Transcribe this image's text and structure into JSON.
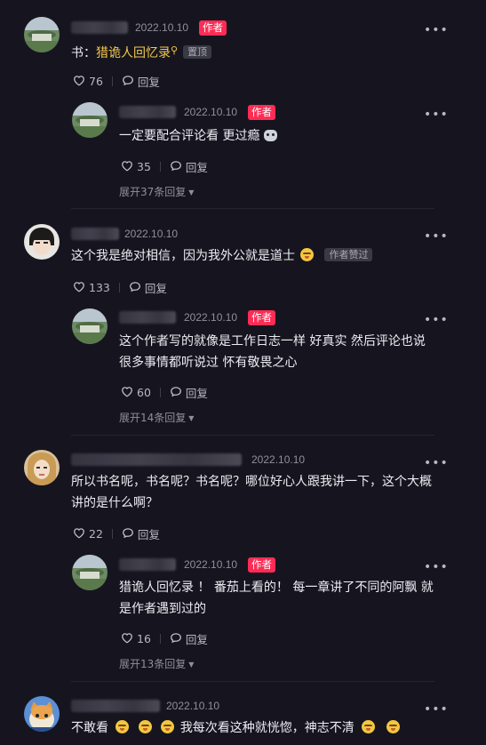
{
  "comments": [
    {
      "date": "2022.10.10",
      "author_badge": "作者",
      "text_prefix": "书：",
      "text_link": "猎诡人回忆录",
      "pin_label": "置顶",
      "likes": "76",
      "reply_label": "回复",
      "reply": {
        "date": "2022.10.10",
        "author_badge": "作者",
        "text": "一定要配合评论看 更过瘾",
        "likes": "35",
        "reply_label": "回复",
        "expand_label": "展开37条回复"
      }
    },
    {
      "date": "2022.10.10",
      "text": "这个我是绝对相信，因为我外公就是道士",
      "liked_label": "作者赞过",
      "likes": "133",
      "reply_label": "回复",
      "reply": {
        "date": "2022.10.10",
        "author_badge": "作者",
        "text_line1": "这个作者写的就像是工作日志一样 好真实 然后评论也说",
        "text_line2": "很多事情都听说过 怀有敬畏之心",
        "likes": "60",
        "reply_label": "回复",
        "expand_label": "展开14条回复"
      }
    },
    {
      "date": "2022.10.10",
      "text_line1": "所以书名呢，书名呢？书名呢？哪位好心人跟我讲一下，这个大概",
      "text_line2": "讲的是什么啊？",
      "likes": "22",
      "reply_label": "回复",
      "reply": {
        "date": "2022.10.10",
        "author_badge": "作者",
        "text_line1": "猎诡人回忆录 ！ 番茄上看的！ 每一章讲了不同的阿飘 就",
        "text_line2": "是作者遇到过的",
        "likes": "16",
        "reply_label": "回复",
        "expand_label": "展开13条回复"
      }
    },
    {
      "date": "2022.10.10",
      "text_a": "不敢看",
      "text_b": "我每次看这种就恍惚，神志不清"
    }
  ],
  "icons": {
    "like": "heart-outline-icon",
    "reply": "reply-bubble-icon",
    "more": "more-dots-icon",
    "search": "search-icon"
  },
  "colors": {
    "background": "#16151f",
    "author_badge": "#fe2c55",
    "book_link": "#f5c84c"
  }
}
